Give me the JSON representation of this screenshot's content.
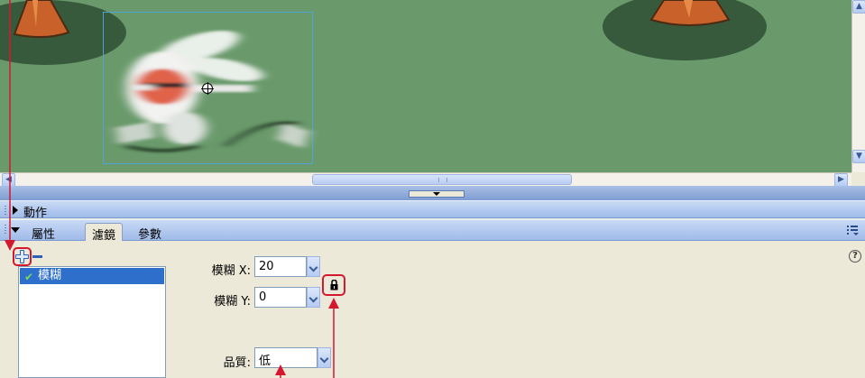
{
  "panels": {
    "actions": {
      "title": "動作"
    },
    "properties": {
      "tabs": [
        {
          "label": "屬性",
          "active": false
        },
        {
          "label": "濾鏡",
          "active": true
        },
        {
          "label": "參數",
          "active": false
        }
      ]
    }
  },
  "filters": {
    "list": [
      {
        "name": "模糊",
        "enabled": true,
        "selected": true
      }
    ],
    "blur_x": {
      "label": "模糊 X:",
      "value": "20"
    },
    "blur_y": {
      "label": "模糊 Y:",
      "value": "0"
    },
    "quality": {
      "label": "品質:",
      "value": "低"
    },
    "constrain_locked": true
  },
  "icons": {
    "add": "plus-icon",
    "remove": "minus-icon",
    "lock": "lock-icon",
    "help": "help-icon",
    "panel_options": "options-menu-icon",
    "check": "check-icon"
  },
  "colors": {
    "stage": "#6a9a6c",
    "stage_shadow": "#385a3c",
    "panel_header": "#9fbbe9",
    "selection": "#2e6fcb",
    "annotation": "#d3182f"
  }
}
